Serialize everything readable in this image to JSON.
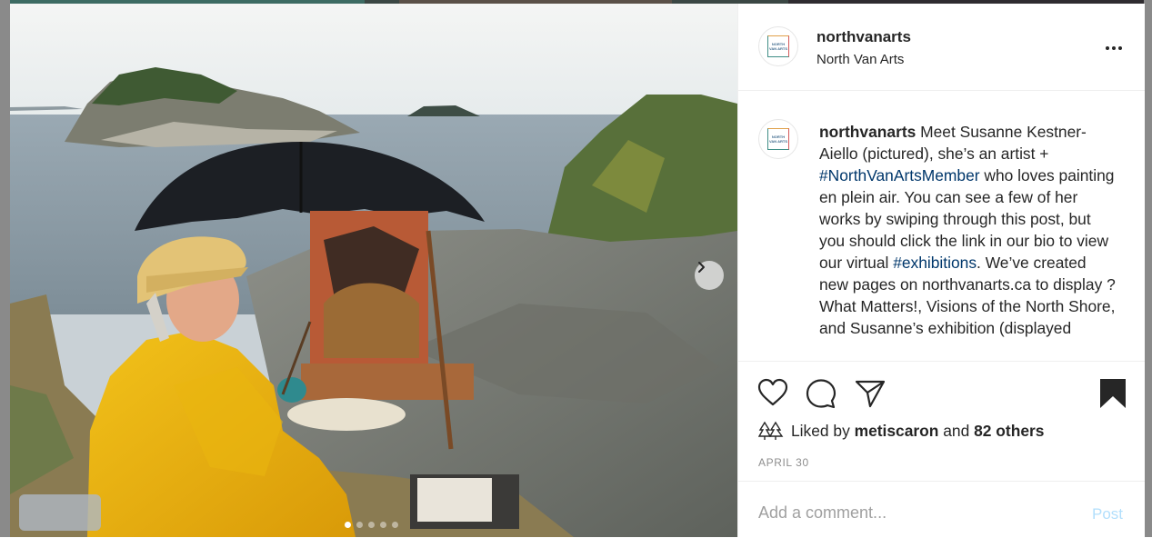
{
  "post": {
    "username": "northvanarts",
    "display_name": "North Van Arts",
    "avatar_text": "NORTH VAN ARTS",
    "caption": {
      "username": "northvanarts",
      "part1": " Meet Susanne Kestner-Aiello (pictured), she’s an artist + ",
      "tag1": "#NorthVanArtsMember",
      "part2": " who loves painting en plein air. You can see a few of her works by swiping through this post, but you should click the link in our bio to view our virtual ",
      "tag2": "#exhibitions",
      "part3": ". We’ve created new pages on northvanarts.ca to display ?What Matters!, Visions of the North Shore, and Susanne’s exhibition (displayed"
    },
    "likes": {
      "prefix": "Liked by ",
      "user": "metiscaron",
      "middle": " and ",
      "others": "82 others"
    },
    "date": "APRIL 30",
    "comment": {
      "placeholder": "Add a comment...",
      "post_label": "Post"
    },
    "carousel": {
      "slide_count": 5,
      "active_index": 0
    }
  },
  "icons": {
    "more": "more-options-icon",
    "like": "heart-icon",
    "comment": "comment-icon",
    "share": "share-icon",
    "save": "bookmark-icon",
    "liked_avatars": "liked-avatars-icon",
    "next": "chevron-right-icon"
  },
  "colors": {
    "text": "#262626",
    "hashtag": "#00376b",
    "muted": "#8e8e8e",
    "post_disabled": "#b2dffc"
  }
}
